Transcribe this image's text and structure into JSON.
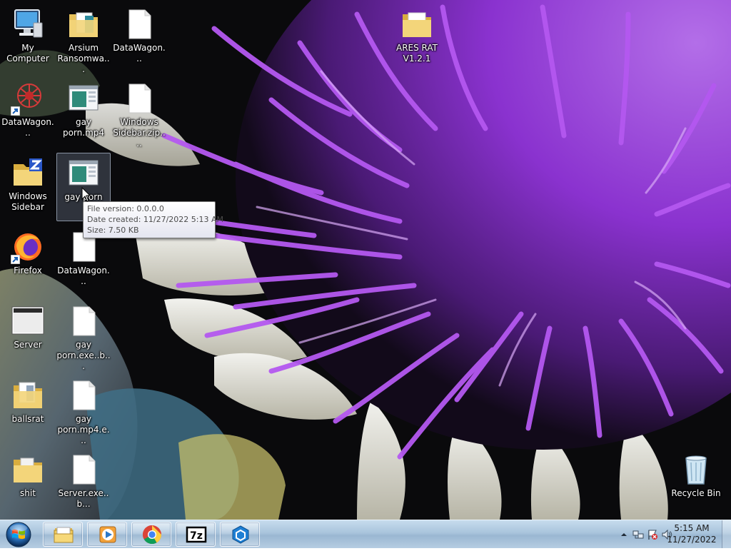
{
  "desktop": {
    "icons": [
      {
        "label": "My Computer",
        "type": "computer"
      },
      {
        "label": "Arsium Ransomwa...",
        "type": "folder-docs"
      },
      {
        "label": "DataWagon...",
        "type": "file-blank"
      },
      {
        "label": "ARES RAT V1.2.1",
        "type": "folder"
      },
      {
        "label": "DataWagon...",
        "type": "datawagon-shortcut"
      },
      {
        "label": "gay porn.mp4",
        "type": "window-file"
      },
      {
        "label": "Windows Sidebar.zip....",
        "type": "file-blank"
      },
      {
        "label": "Windows Sidebar",
        "type": "zip-folder"
      },
      {
        "label": "gay porn",
        "type": "window-file"
      },
      {
        "label": "Firefox",
        "type": "firefox-shortcut"
      },
      {
        "label": "DataWagon...",
        "type": "file-blank"
      },
      {
        "label": "Server",
        "type": "window-app"
      },
      {
        "label": "gay porn.exe..b...",
        "type": "file-blank"
      },
      {
        "label": "ballsrat",
        "type": "folder-docs"
      },
      {
        "label": "gay porn.mp4.e...",
        "type": "file-blank"
      },
      {
        "label": "shit",
        "type": "folder"
      },
      {
        "label": "Server.exe..b...",
        "type": "file-blank"
      },
      {
        "label": "Recycle Bin",
        "type": "recycle-bin"
      }
    ],
    "tooltip": {
      "file_version": "File version: 0.0.0.0",
      "date_created": "Date created: 11/27/2022 5:13 AM",
      "size": "Size: 7.50 KB"
    }
  },
  "taskbar": {
    "start_icon": "windows-orb-icon",
    "pinned": [
      {
        "name": "windows-explorer",
        "icon": "folder-icon"
      },
      {
        "name": "media-player",
        "icon": "media-player-icon"
      },
      {
        "name": "chrome",
        "icon": "chrome-icon"
      },
      {
        "name": "7zip",
        "icon": "7zip-icon"
      },
      {
        "name": "app-hexagon",
        "icon": "hexagon-icon"
      }
    ],
    "tray": {
      "time": "5:15 AM",
      "date": "11/27/2022",
      "icons": [
        "show-hidden-icons-arrow",
        "network-icon",
        "action-center-flag-icon",
        "volume-icon"
      ]
    }
  },
  "colors": {
    "taskbar_top": "#c7dcee",
    "taskbar_bottom": "#9ab7d2",
    "wallpaper_purple": "#a34be0",
    "icon_label": "#ffffff"
  }
}
